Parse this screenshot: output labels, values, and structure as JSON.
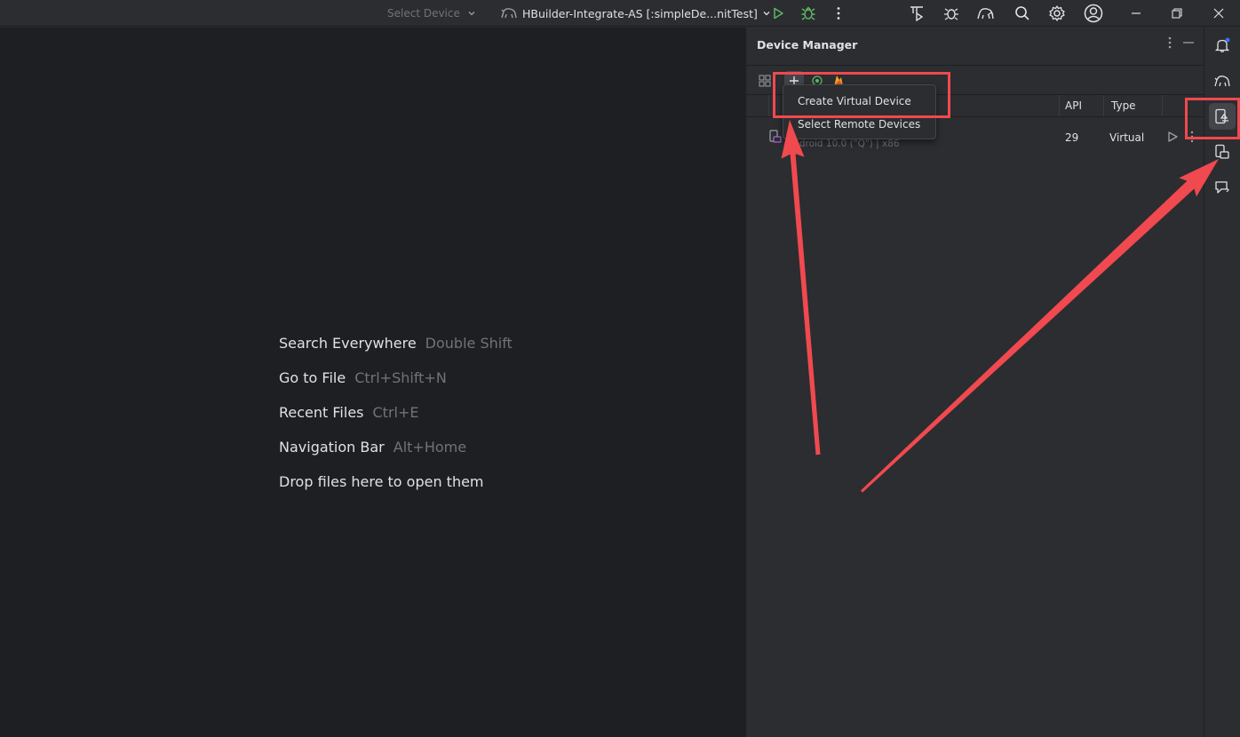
{
  "titlebar": {
    "select_device": "Select Device",
    "run_config": "HBuilder-Integrate-AS [:simpleDe...nitTest]",
    "icons": [
      "run-icon",
      "debug-icon",
      "more-vert-icon",
      "profiler-icon",
      "bug-sync-icon",
      "gradle-sync-icon",
      "search-icon",
      "gear-icon",
      "account-icon",
      "minimize-icon",
      "restore-icon",
      "close-icon"
    ]
  },
  "editor": {
    "hints": [
      {
        "action": "Search Everywhere",
        "shortcut": "Double Shift"
      },
      {
        "action": "Go to File",
        "shortcut": "Ctrl+Shift+N"
      },
      {
        "action": "Recent Files",
        "shortcut": "Ctrl+E"
      },
      {
        "action": "Navigation Bar",
        "shortcut": "Alt+Home"
      },
      {
        "action": "Drop files here to open them",
        "shortcut": ""
      }
    ]
  },
  "device_manager": {
    "title": "Device Manager",
    "columns": {
      "api": "API",
      "type": "Type"
    },
    "device": {
      "subtitle": "Android 10.0 (\"Q\") | x86",
      "api": "29",
      "type": "Virtual"
    },
    "popup": [
      {
        "label": "Create Virtual Device"
      },
      {
        "label": "Select Remote Devices"
      }
    ]
  },
  "right_strip": {
    "icons": [
      "notifications-icon",
      "gradle-elephant-icon",
      "device-manager-icon",
      "running-devices-icon",
      "app-quality-icon"
    ]
  },
  "colors": {
    "accent": "#f0494f",
    "run_green": "#5fb865",
    "background": "#2b2d30",
    "editor_bg": "#1e1f22"
  }
}
